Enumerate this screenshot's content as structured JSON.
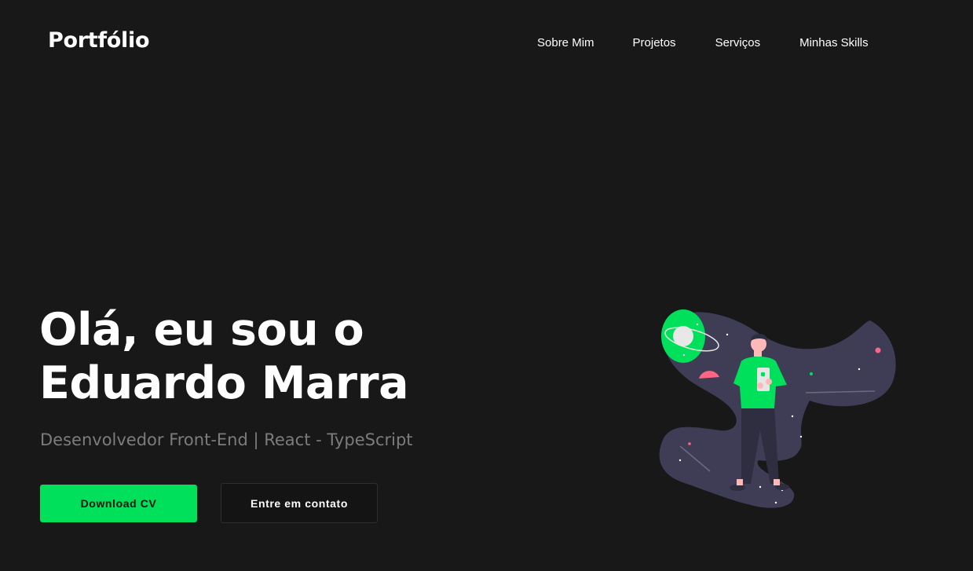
{
  "header": {
    "logo": "Portfólio",
    "nav": [
      {
        "label": "Sobre Mim"
      },
      {
        "label": "Projetos"
      },
      {
        "label": "Serviços"
      },
      {
        "label": "Minhas Skills"
      }
    ]
  },
  "hero": {
    "title_line1": "Olá, eu sou o",
    "title_line2": "Eduardo Marra",
    "subtitle": "Desenvolvedor Front-End | React - TypeScript",
    "primary_button": "Download CV",
    "secondary_button": "Entre em contato"
  },
  "colors": {
    "background": "#181818",
    "accent": "#00e05a",
    "subtitle": "#7c7c7c",
    "space_path": "#3f3d56",
    "planet_pink": "#ff6584"
  },
  "illustration": {
    "icon": "space-person-illustration"
  }
}
